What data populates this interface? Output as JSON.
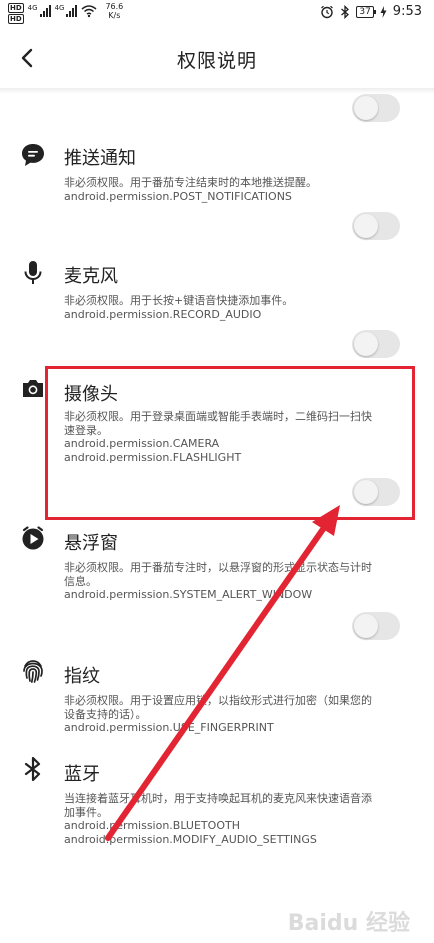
{
  "status_bar": {
    "hd1": "HD",
    "hd2": "HD",
    "net1": "4G",
    "net2": "4G",
    "speed_value": "76.6",
    "speed_unit": "K/s",
    "battery": "37",
    "time": "9:53"
  },
  "header": {
    "title": "权限说明"
  },
  "permissions": [
    {
      "title": "推送通知",
      "lines": [
        "非必须权限。用于番茄专注结束时的本地推送提醒。",
        "android.permission.POST_NOTIFICATIONS"
      ],
      "icon": "chat-bubble-icon"
    },
    {
      "title": "麦克风",
      "lines": [
        "非必须权限。用于长按+键语音快捷添加事件。",
        "android.permission.RECORD_AUDIO"
      ],
      "icon": "microphone-icon"
    },
    {
      "title": "摄像头",
      "lines": [
        "非必须权限。用于登录桌面端或智能手表端时，二维码扫一扫快",
        "速登录。",
        "android.permission.CAMERA",
        "android.permission.FLASHLIGHT"
      ],
      "icon": "camera-icon"
    },
    {
      "title": "悬浮窗",
      "lines": [
        "非必须权限。用于番茄专注时，以悬浮窗的形式显示状态与计时",
        "信息。",
        "android.permission.SYSTEM_ALERT_WINDOW"
      ],
      "icon": "timer-play-icon"
    },
    {
      "title": "指纹",
      "lines": [
        "非必须权限。用于设置应用锁，以指纹形式进行加密（如果您的",
        "设备支持的话）。",
        "android.permission.USE_FINGERPRINT"
      ],
      "icon": "fingerprint-icon"
    },
    {
      "title": "蓝牙",
      "lines": [
        "当连接着蓝牙耳机时，用于支持唤起耳机的麦克风来快速语音添",
        "加事件。",
        "android.permission.BLUETOOTH",
        "android.permission.MODIFY_AUDIO_SETTINGS"
      ],
      "icon": "bluetooth-icon"
    }
  ],
  "toggles": [
    {
      "on": false
    },
    {
      "on": false
    },
    {
      "on": false
    },
    {
      "on": false
    },
    {
      "on": false
    }
  ],
  "watermark": "Baidu 经验",
  "colors": {
    "annotation": "#e32432",
    "toggle_track": "#e6e6e6",
    "toggle_knob": "#f3f3f3"
  }
}
